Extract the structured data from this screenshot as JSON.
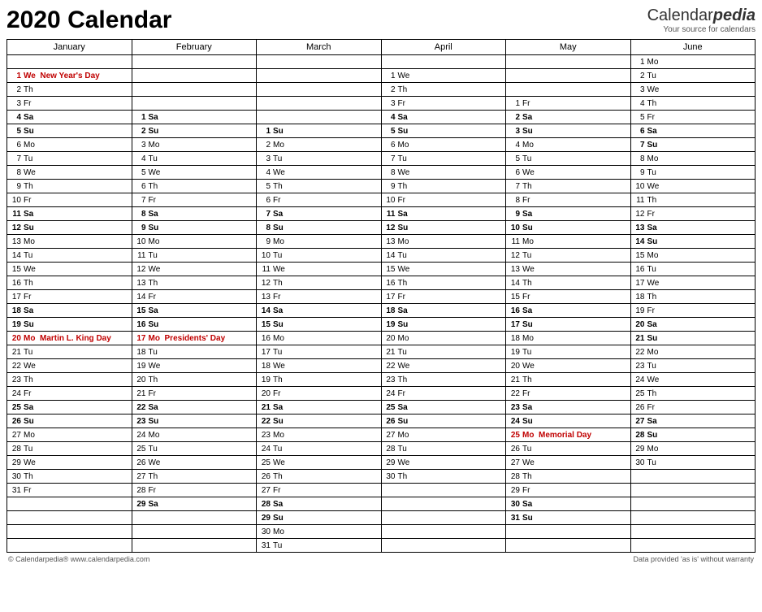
{
  "title": "2020 Calendar",
  "brand": {
    "name1": "Calendar",
    "name2": "pedia",
    "tagline": "Your source for calendars"
  },
  "months": [
    "January",
    "February",
    "March",
    "April",
    "May",
    "June"
  ],
  "rows": [
    [
      null,
      null,
      null,
      null,
      null,
      {
        "d": 1,
        "w": "Mo"
      }
    ],
    [
      {
        "d": 1,
        "w": "We",
        "h": "New Year's Day"
      },
      null,
      null,
      {
        "d": 1,
        "w": "We"
      },
      null,
      {
        "d": 2,
        "w": "Tu"
      }
    ],
    [
      {
        "d": 2,
        "w": "Th"
      },
      null,
      null,
      {
        "d": 2,
        "w": "Th"
      },
      null,
      {
        "d": 3,
        "w": "We"
      }
    ],
    [
      {
        "d": 3,
        "w": "Fr"
      },
      null,
      null,
      {
        "d": 3,
        "w": "Fr"
      },
      {
        "d": 1,
        "w": "Fr"
      },
      {
        "d": 4,
        "w": "Th"
      }
    ],
    [
      {
        "d": 4,
        "w": "Sa",
        "t": "sat"
      },
      {
        "d": 1,
        "w": "Sa",
        "t": "sat"
      },
      null,
      {
        "d": 4,
        "w": "Sa",
        "t": "sat"
      },
      {
        "d": 2,
        "w": "Sa",
        "t": "sat"
      },
      {
        "d": 5,
        "w": "Fr"
      }
    ],
    [
      {
        "d": 5,
        "w": "Su",
        "t": "sun"
      },
      {
        "d": 2,
        "w": "Su",
        "t": "sun"
      },
      {
        "d": 1,
        "w": "Su",
        "t": "sun"
      },
      {
        "d": 5,
        "w": "Su",
        "t": "sun"
      },
      {
        "d": 3,
        "w": "Su",
        "t": "sun"
      },
      {
        "d": 6,
        "w": "Sa",
        "t": "sat"
      }
    ],
    [
      {
        "d": 6,
        "w": "Mo"
      },
      {
        "d": 3,
        "w": "Mo"
      },
      {
        "d": 2,
        "w": "Mo"
      },
      {
        "d": 6,
        "w": "Mo"
      },
      {
        "d": 4,
        "w": "Mo"
      },
      {
        "d": 7,
        "w": "Su",
        "t": "sun"
      }
    ],
    [
      {
        "d": 7,
        "w": "Tu"
      },
      {
        "d": 4,
        "w": "Tu"
      },
      {
        "d": 3,
        "w": "Tu"
      },
      {
        "d": 7,
        "w": "Tu"
      },
      {
        "d": 5,
        "w": "Tu"
      },
      {
        "d": 8,
        "w": "Mo"
      }
    ],
    [
      {
        "d": 8,
        "w": "We"
      },
      {
        "d": 5,
        "w": "We"
      },
      {
        "d": 4,
        "w": "We"
      },
      {
        "d": 8,
        "w": "We"
      },
      {
        "d": 6,
        "w": "We"
      },
      {
        "d": 9,
        "w": "Tu"
      }
    ],
    [
      {
        "d": 9,
        "w": "Th"
      },
      {
        "d": 6,
        "w": "Th"
      },
      {
        "d": 5,
        "w": "Th"
      },
      {
        "d": 9,
        "w": "Th"
      },
      {
        "d": 7,
        "w": "Th"
      },
      {
        "d": 10,
        "w": "We"
      }
    ],
    [
      {
        "d": 10,
        "w": "Fr"
      },
      {
        "d": 7,
        "w": "Fr"
      },
      {
        "d": 6,
        "w": "Fr"
      },
      {
        "d": 10,
        "w": "Fr"
      },
      {
        "d": 8,
        "w": "Fr"
      },
      {
        "d": 11,
        "w": "Th"
      }
    ],
    [
      {
        "d": 11,
        "w": "Sa",
        "t": "sat"
      },
      {
        "d": 8,
        "w": "Sa",
        "t": "sat"
      },
      {
        "d": 7,
        "w": "Sa",
        "t": "sat"
      },
      {
        "d": 11,
        "w": "Sa",
        "t": "sat"
      },
      {
        "d": 9,
        "w": "Sa",
        "t": "sat"
      },
      {
        "d": 12,
        "w": "Fr"
      }
    ],
    [
      {
        "d": 12,
        "w": "Su",
        "t": "sun"
      },
      {
        "d": 9,
        "w": "Su",
        "t": "sun"
      },
      {
        "d": 8,
        "w": "Su",
        "t": "sun"
      },
      {
        "d": 12,
        "w": "Su",
        "t": "sun"
      },
      {
        "d": 10,
        "w": "Su",
        "t": "sun"
      },
      {
        "d": 13,
        "w": "Sa",
        "t": "sat"
      }
    ],
    [
      {
        "d": 13,
        "w": "Mo"
      },
      {
        "d": 10,
        "w": "Mo"
      },
      {
        "d": 9,
        "w": "Mo"
      },
      {
        "d": 13,
        "w": "Mo"
      },
      {
        "d": 11,
        "w": "Mo"
      },
      {
        "d": 14,
        "w": "Su",
        "t": "sun"
      }
    ],
    [
      {
        "d": 14,
        "w": "Tu"
      },
      {
        "d": 11,
        "w": "Tu"
      },
      {
        "d": 10,
        "w": "Tu"
      },
      {
        "d": 14,
        "w": "Tu"
      },
      {
        "d": 12,
        "w": "Tu"
      },
      {
        "d": 15,
        "w": "Mo"
      }
    ],
    [
      {
        "d": 15,
        "w": "We"
      },
      {
        "d": 12,
        "w": "We"
      },
      {
        "d": 11,
        "w": "We"
      },
      {
        "d": 15,
        "w": "We"
      },
      {
        "d": 13,
        "w": "We"
      },
      {
        "d": 16,
        "w": "Tu"
      }
    ],
    [
      {
        "d": 16,
        "w": "Th"
      },
      {
        "d": 13,
        "w": "Th"
      },
      {
        "d": 12,
        "w": "Th"
      },
      {
        "d": 16,
        "w": "Th"
      },
      {
        "d": 14,
        "w": "Th"
      },
      {
        "d": 17,
        "w": "We"
      }
    ],
    [
      {
        "d": 17,
        "w": "Fr"
      },
      {
        "d": 14,
        "w": "Fr"
      },
      {
        "d": 13,
        "w": "Fr"
      },
      {
        "d": 17,
        "w": "Fr"
      },
      {
        "d": 15,
        "w": "Fr"
      },
      {
        "d": 18,
        "w": "Th"
      }
    ],
    [
      {
        "d": 18,
        "w": "Sa",
        "t": "sat"
      },
      {
        "d": 15,
        "w": "Sa",
        "t": "sat"
      },
      {
        "d": 14,
        "w": "Sa",
        "t": "sat"
      },
      {
        "d": 18,
        "w": "Sa",
        "t": "sat"
      },
      {
        "d": 16,
        "w": "Sa",
        "t": "sat"
      },
      {
        "d": 19,
        "w": "Fr"
      }
    ],
    [
      {
        "d": 19,
        "w": "Su",
        "t": "sun"
      },
      {
        "d": 16,
        "w": "Su",
        "t": "sun"
      },
      {
        "d": 15,
        "w": "Su",
        "t": "sun"
      },
      {
        "d": 19,
        "w": "Su",
        "t": "sun"
      },
      {
        "d": 17,
        "w": "Su",
        "t": "sun"
      },
      {
        "d": 20,
        "w": "Sa",
        "t": "sat"
      }
    ],
    [
      {
        "d": 20,
        "w": "Mo",
        "h": "Martin L. King Day"
      },
      {
        "d": 17,
        "w": "Mo",
        "h": "Presidents' Day"
      },
      {
        "d": 16,
        "w": "Mo"
      },
      {
        "d": 20,
        "w": "Mo"
      },
      {
        "d": 18,
        "w": "Mo"
      },
      {
        "d": 21,
        "w": "Su",
        "t": "sun"
      }
    ],
    [
      {
        "d": 21,
        "w": "Tu"
      },
      {
        "d": 18,
        "w": "Tu"
      },
      {
        "d": 17,
        "w": "Tu"
      },
      {
        "d": 21,
        "w": "Tu"
      },
      {
        "d": 19,
        "w": "Tu"
      },
      {
        "d": 22,
        "w": "Mo"
      }
    ],
    [
      {
        "d": 22,
        "w": "We"
      },
      {
        "d": 19,
        "w": "We"
      },
      {
        "d": 18,
        "w": "We"
      },
      {
        "d": 22,
        "w": "We"
      },
      {
        "d": 20,
        "w": "We"
      },
      {
        "d": 23,
        "w": "Tu"
      }
    ],
    [
      {
        "d": 23,
        "w": "Th"
      },
      {
        "d": 20,
        "w": "Th"
      },
      {
        "d": 19,
        "w": "Th"
      },
      {
        "d": 23,
        "w": "Th"
      },
      {
        "d": 21,
        "w": "Th"
      },
      {
        "d": 24,
        "w": "We"
      }
    ],
    [
      {
        "d": 24,
        "w": "Fr"
      },
      {
        "d": 21,
        "w": "Fr"
      },
      {
        "d": 20,
        "w": "Fr"
      },
      {
        "d": 24,
        "w": "Fr"
      },
      {
        "d": 22,
        "w": "Fr"
      },
      {
        "d": 25,
        "w": "Th"
      }
    ],
    [
      {
        "d": 25,
        "w": "Sa",
        "t": "sat"
      },
      {
        "d": 22,
        "w": "Sa",
        "t": "sat"
      },
      {
        "d": 21,
        "w": "Sa",
        "t": "sat"
      },
      {
        "d": 25,
        "w": "Sa",
        "t": "sat"
      },
      {
        "d": 23,
        "w": "Sa",
        "t": "sat"
      },
      {
        "d": 26,
        "w": "Fr"
      }
    ],
    [
      {
        "d": 26,
        "w": "Su",
        "t": "sun"
      },
      {
        "d": 23,
        "w": "Su",
        "t": "sun"
      },
      {
        "d": 22,
        "w": "Su",
        "t": "sun"
      },
      {
        "d": 26,
        "w": "Su",
        "t": "sun"
      },
      {
        "d": 24,
        "w": "Su",
        "t": "sun"
      },
      {
        "d": 27,
        "w": "Sa",
        "t": "sat"
      }
    ],
    [
      {
        "d": 27,
        "w": "Mo"
      },
      {
        "d": 24,
        "w": "Mo"
      },
      {
        "d": 23,
        "w": "Mo"
      },
      {
        "d": 27,
        "w": "Mo"
      },
      {
        "d": 25,
        "w": "Mo",
        "h": "Memorial Day"
      },
      {
        "d": 28,
        "w": "Su",
        "t": "sun"
      }
    ],
    [
      {
        "d": 28,
        "w": "Tu"
      },
      {
        "d": 25,
        "w": "Tu"
      },
      {
        "d": 24,
        "w": "Tu"
      },
      {
        "d": 28,
        "w": "Tu"
      },
      {
        "d": 26,
        "w": "Tu"
      },
      {
        "d": 29,
        "w": "Mo"
      }
    ],
    [
      {
        "d": 29,
        "w": "We"
      },
      {
        "d": 26,
        "w": "We"
      },
      {
        "d": 25,
        "w": "We"
      },
      {
        "d": 29,
        "w": "We"
      },
      {
        "d": 27,
        "w": "We"
      },
      {
        "d": 30,
        "w": "Tu"
      }
    ],
    [
      {
        "d": 30,
        "w": "Th"
      },
      {
        "d": 27,
        "w": "Th"
      },
      {
        "d": 26,
        "w": "Th"
      },
      {
        "d": 30,
        "w": "Th"
      },
      {
        "d": 28,
        "w": "Th"
      },
      null
    ],
    [
      {
        "d": 31,
        "w": "Fr"
      },
      {
        "d": 28,
        "w": "Fr"
      },
      {
        "d": 27,
        "w": "Fr"
      },
      null,
      {
        "d": 29,
        "w": "Fr"
      },
      null
    ],
    [
      null,
      {
        "d": 29,
        "w": "Sa",
        "t": "sat"
      },
      {
        "d": 28,
        "w": "Sa",
        "t": "sat"
      },
      null,
      {
        "d": 30,
        "w": "Sa",
        "t": "sat"
      },
      null
    ],
    [
      null,
      null,
      {
        "d": 29,
        "w": "Su",
        "t": "sun"
      },
      null,
      {
        "d": 31,
        "w": "Su",
        "t": "sun"
      },
      null
    ],
    [
      null,
      null,
      {
        "d": 30,
        "w": "Mo"
      },
      null,
      null,
      null
    ],
    [
      null,
      null,
      {
        "d": 31,
        "w": "Tu"
      },
      null,
      null,
      null
    ]
  ],
  "footer": {
    "left": "© Calendarpedia®   www.calendarpedia.com",
    "right": "Data provided 'as is' without warranty"
  }
}
